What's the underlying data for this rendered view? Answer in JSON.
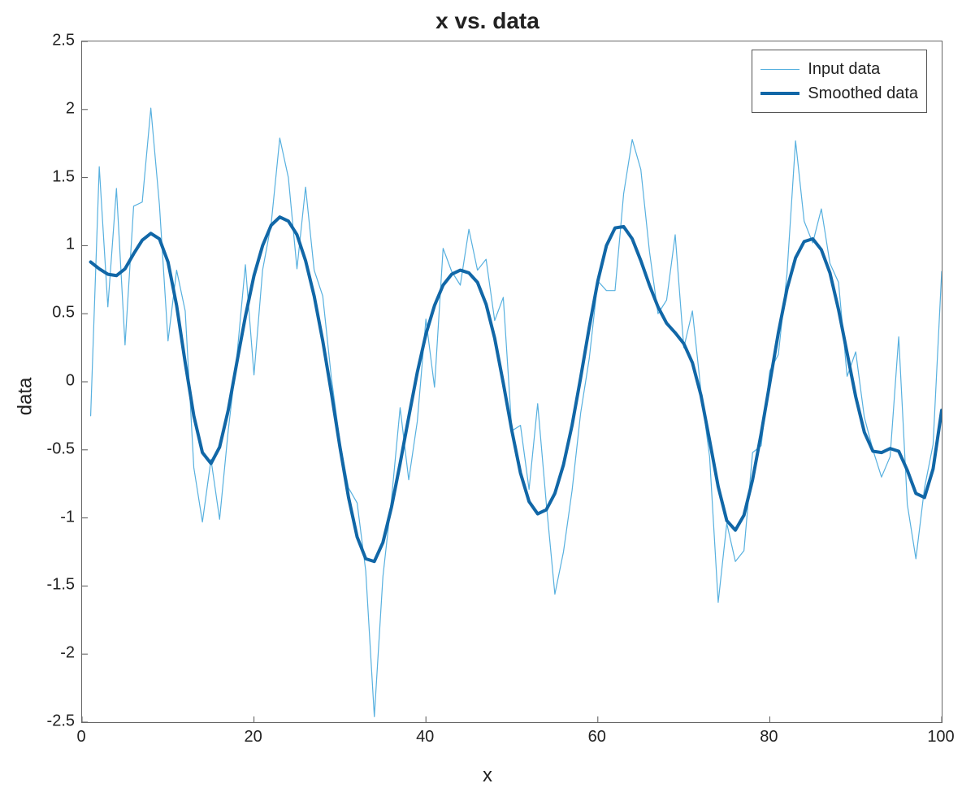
{
  "chart_data": {
    "type": "line",
    "title": "x vs. data",
    "xlabel": "x",
    "ylabel": "data",
    "xlim": [
      0,
      100
    ],
    "ylim": [
      -2.5,
      2.5
    ],
    "xticks": [
      0,
      20,
      40,
      60,
      80,
      100
    ],
    "yticks": [
      -2.5,
      -2,
      -1.5,
      -1,
      -0.5,
      0,
      0.5,
      1,
      1.5,
      2,
      2.5
    ],
    "legend": [
      "Input data",
      "Smoothed data"
    ],
    "colors": {
      "input": "#57b0df",
      "smoothed": "#1167a7"
    },
    "series": [
      {
        "name": "Input data",
        "x": [
          1,
          2,
          3,
          4,
          5,
          6,
          7,
          8,
          9,
          10,
          11,
          12,
          13,
          14,
          15,
          16,
          17,
          18,
          19,
          20,
          21,
          22,
          23,
          24,
          25,
          26,
          27,
          28,
          29,
          30,
          31,
          32,
          33,
          34,
          35,
          36,
          37,
          38,
          39,
          40,
          41,
          42,
          43,
          44,
          45,
          46,
          47,
          48,
          49,
          50,
          51,
          52,
          53,
          54,
          55,
          56,
          57,
          58,
          59,
          60,
          61,
          62,
          63,
          64,
          65,
          66,
          67,
          68,
          69,
          70,
          71,
          72,
          73,
          74,
          75,
          76,
          77,
          78,
          79,
          80,
          81,
          82,
          83,
          84,
          85,
          86,
          87,
          88,
          89,
          90,
          91,
          92,
          93,
          94,
          95,
          96,
          97,
          98,
          99,
          100
        ],
        "y": [
          -0.25,
          1.58,
          0.55,
          1.42,
          0.27,
          1.29,
          1.32,
          2.01,
          1.3,
          0.3,
          0.82,
          0.52,
          -0.63,
          -1.03,
          -0.57,
          -1.01,
          -0.36,
          0.18,
          0.86,
          0.05,
          0.82,
          1.16,
          1.79,
          1.5,
          0.83,
          1.43,
          0.82,
          0.63,
          0.03,
          -0.44,
          -0.78,
          -0.89,
          -1.39,
          -2.46,
          -1.43,
          -0.86,
          -0.19,
          -0.72,
          -0.29,
          0.46,
          -0.04,
          0.98,
          0.81,
          0.71,
          1.12,
          0.82,
          0.9,
          0.45,
          0.62,
          -0.36,
          -0.32,
          -0.79,
          -0.16,
          -0.89,
          -1.56,
          -1.25,
          -0.8,
          -0.23,
          0.17,
          0.74,
          0.67,
          0.67,
          1.38,
          1.78,
          1.56,
          0.96,
          0.5,
          0.6,
          1.08,
          0.25,
          0.52,
          -0.07,
          -0.55,
          -1.62,
          -1.04,
          -1.32,
          -1.24,
          -0.52,
          -0.47,
          0.08,
          0.2,
          0.79,
          1.77,
          1.18,
          1.02,
          1.27,
          0.87,
          0.73,
          0.04,
          0.22,
          -0.26,
          -0.5,
          -0.7,
          -0.55,
          0.33,
          -0.9,
          -1.3,
          -0.78,
          -0.46,
          0.81
        ],
        "color": "#57b0df",
        "linewidth": 1.2
      },
      {
        "name": "Smoothed data",
        "x": [
          1,
          2,
          3,
          4,
          5,
          6,
          7,
          8,
          9,
          10,
          11,
          12,
          13,
          14,
          15,
          16,
          17,
          18,
          19,
          20,
          21,
          22,
          23,
          24,
          25,
          26,
          27,
          28,
          29,
          30,
          31,
          32,
          33,
          34,
          35,
          36,
          37,
          38,
          39,
          40,
          41,
          42,
          43,
          44,
          45,
          46,
          47,
          48,
          49,
          50,
          51,
          52,
          53,
          54,
          55,
          56,
          57,
          58,
          59,
          60,
          61,
          62,
          63,
          64,
          65,
          66,
          67,
          68,
          69,
          70,
          71,
          72,
          73,
          74,
          75,
          76,
          77,
          78,
          79,
          80,
          81,
          82,
          83,
          84,
          85,
          86,
          87,
          88,
          89,
          90,
          91,
          92,
          93,
          94,
          95,
          96,
          97,
          98,
          99,
          100
        ],
        "y": [
          0.88,
          0.83,
          0.79,
          0.78,
          0.83,
          0.94,
          1.04,
          1.09,
          1.05,
          0.88,
          0.56,
          0.14,
          -0.25,
          -0.52,
          -0.6,
          -0.48,
          -0.21,
          0.14,
          0.48,
          0.78,
          1.0,
          1.15,
          1.21,
          1.18,
          1.08,
          0.89,
          0.63,
          0.3,
          -0.08,
          -0.48,
          -0.85,
          -1.14,
          -1.3,
          -1.32,
          -1.18,
          -0.92,
          -0.6,
          -0.26,
          0.07,
          0.35,
          0.56,
          0.71,
          0.79,
          0.82,
          0.8,
          0.73,
          0.57,
          0.32,
          -0.01,
          -0.36,
          -0.67,
          -0.88,
          -0.97,
          -0.94,
          -0.82,
          -0.61,
          -0.32,
          0.03,
          0.4,
          0.74,
          1.0,
          1.13,
          1.14,
          1.05,
          0.89,
          0.71,
          0.55,
          0.43,
          0.36,
          0.28,
          0.14,
          -0.1,
          -0.43,
          -0.77,
          -1.02,
          -1.09,
          -0.98,
          -0.72,
          -0.38,
          -0.01,
          0.36,
          0.68,
          0.91,
          1.03,
          1.05,
          0.97,
          0.8,
          0.53,
          0.21,
          -0.11,
          -0.37,
          -0.51,
          -0.52,
          -0.49,
          -0.51,
          -0.65,
          -0.82,
          -0.85,
          -0.64,
          -0.21
        ],
        "color": "#1167a7",
        "linewidth": 4
      }
    ]
  }
}
